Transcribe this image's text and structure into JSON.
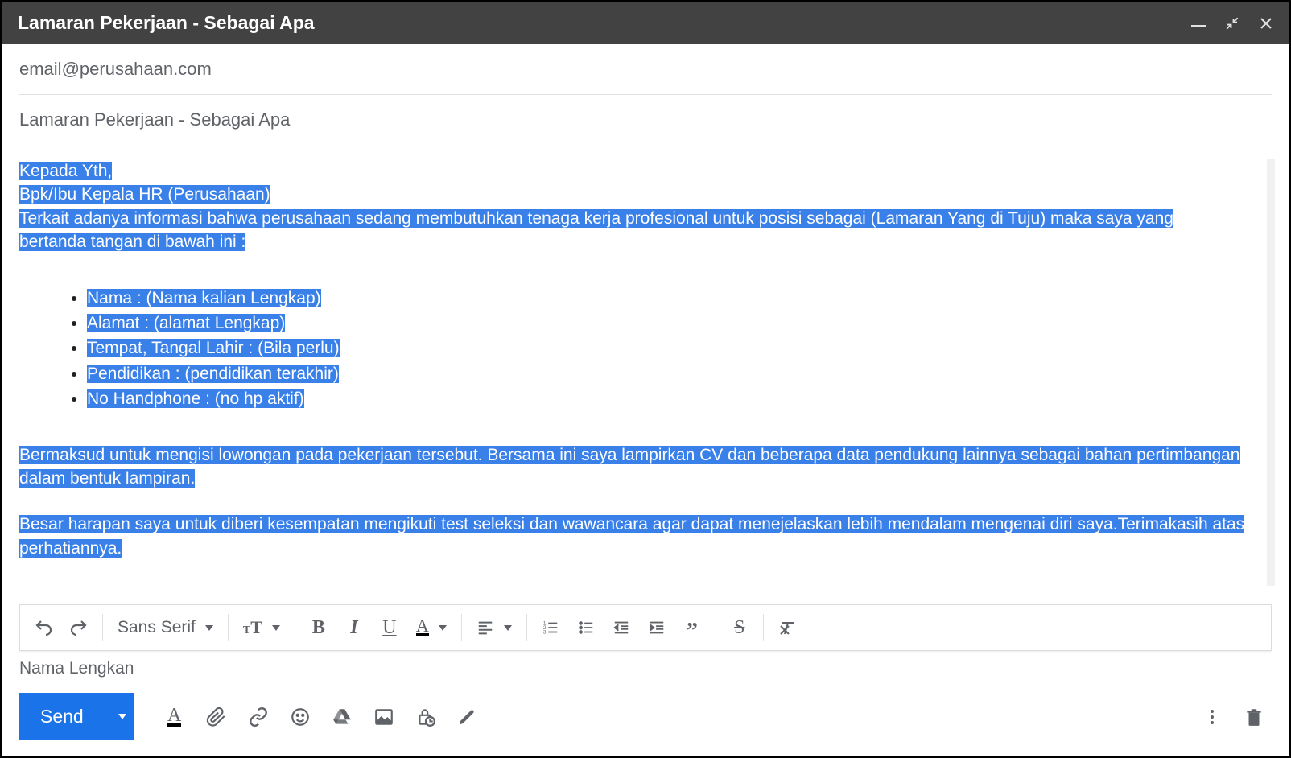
{
  "window": {
    "title": "Lamaran Pekerjaan - Sebagai Apa"
  },
  "fields": {
    "to": "email@perusahaan.com",
    "subject": "Lamaran Pekerjaan - Sebagai Apa"
  },
  "body": {
    "line1": "Kepada Yth,",
    "line2": "Bpk/Ibu Kepala HR (Perusahaan)",
    "line3": "Terkait adanya informasi bahwa perusahaan sedang membutuhkan tenaga kerja profesional untuk posisi sebagai (Lamaran Yang di Tuju)  maka saya yang",
    "line4": "bertanda tangan di bawah ini :",
    "list": [
      "Nama                         : (Nama kalian Lengkap)",
      "Alamat                       : (alamat Lengkap)",
      "Tempat, Tangal Lahir    : (Bila perlu)",
      "Pendidikan                  : (pendidikan terakhir)",
      "No Handphone             : (no hp aktif)"
    ],
    "para2": "Bermaksud untuk mengisi lowongan pada pekerjaan tersebut. Bersama ini saya lampirkan CV dan beberapa data pendukung lainnya sebagai bahan pertimbangan dalam bentuk lampiran.",
    "para3": " Besar harapan saya untuk diberi kesempatan mengikuti test seleksi dan wawancara  agar dapat menejelaskan lebih mendalam mengenai diri saya.Terimakasih atas perhatiannya.",
    "clipped": "Nama Lengkan"
  },
  "format": {
    "font_family": "Sans Serif"
  },
  "actions": {
    "send": "Send"
  }
}
